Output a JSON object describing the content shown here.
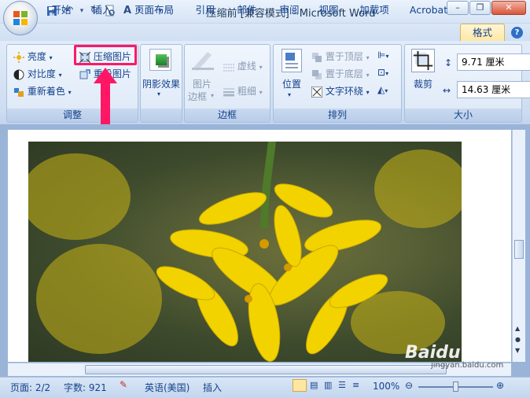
{
  "titlebar": {
    "title": "压缩前 [兼容模式] - Microsoft Word",
    "qa_icons": [
      "save-icon",
      "undo-icon",
      "redo-icon",
      "print-preview-icon",
      "spellcheck-icon",
      "customize-qat-icon"
    ]
  },
  "tabs": [
    "开始",
    "插入",
    "页面布局",
    "引用",
    "邮件",
    "审阅",
    "视图",
    "加载项",
    "Acrobat",
    "格式"
  ],
  "help": "?",
  "groups": {
    "adjust": {
      "label": "调整",
      "brightness": "亮度",
      "contrast": "对比度",
      "recolor": "重新着色",
      "compress": "压缩图片",
      "reset": "重设图片"
    },
    "shadow": {
      "label": "阴影效果",
      "button": "阴影效果"
    },
    "border": {
      "label": "边框",
      "frame_line1": "图片",
      "frame_line2": "边框",
      "dashes": "虚线",
      "weight": "粗细"
    },
    "arrange": {
      "label": "排列",
      "position": "位置",
      "bring_front": "置于顶层",
      "send_back": "置于底层",
      "text_wrap": "文字环绕"
    },
    "size": {
      "label": "大小",
      "crop": "裁剪",
      "height": "9.71 厘米",
      "width": "14.63 厘米"
    }
  },
  "status": {
    "page": "页面: 2/2",
    "words": "字数: 921",
    "language": "英语(美国)",
    "insert": "插入",
    "zoom": "100%"
  },
  "watermark": "Baidu 经验",
  "watermark_sub": "jingyan.baidu.com",
  "colors": {
    "highlight": "#ff1766",
    "ribbon": "#dbe7f6",
    "format_tab": "#ffe7a2"
  }
}
